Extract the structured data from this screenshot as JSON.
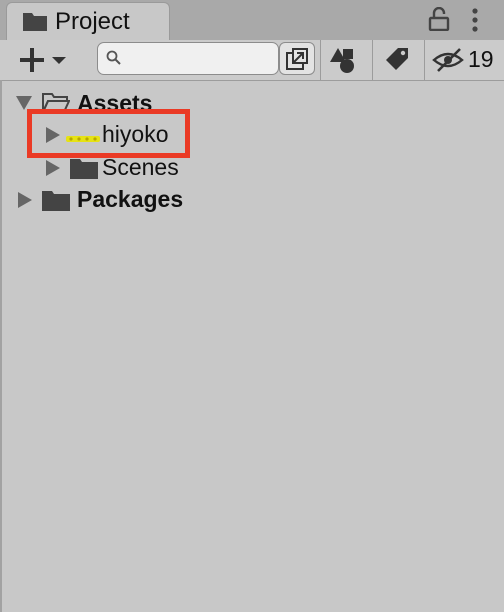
{
  "tab": {
    "label": "Project"
  },
  "toolbar": {
    "search": {
      "value": "",
      "placeholder": ""
    },
    "hidden_count": "19"
  },
  "tree": {
    "assets": "Assets",
    "hiyoko": "hiyoko",
    "scenes": "Scenes",
    "packages": "Packages"
  },
  "colors": {
    "highlight": "#ea3a25",
    "panel": "#c8c8c8",
    "hiyoko_icon": "#e6e214"
  }
}
